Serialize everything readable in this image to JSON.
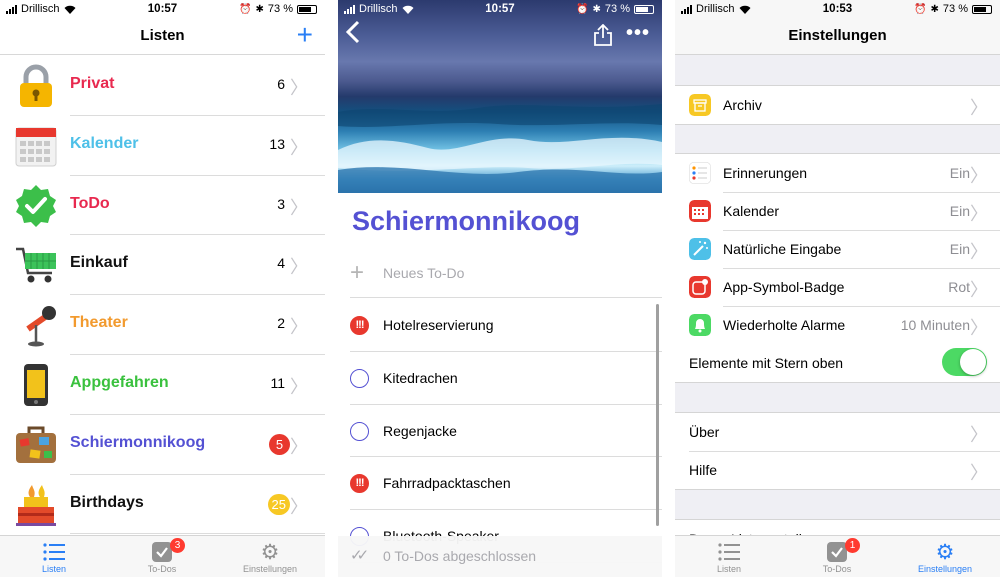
{
  "panel1": {
    "status": {
      "carrier": "Drillisch",
      "time": "10:57",
      "battery": "73 %"
    },
    "nav_title": "Listen",
    "add_symbol": "+",
    "lists": [
      {
        "name": "Privat",
        "count": "6",
        "color": "#e8294f",
        "icon": "lock-icon"
      },
      {
        "name": "Kalender",
        "count": "13",
        "color": "#4ec0e8",
        "icon": "calendar-icon"
      },
      {
        "name": "ToDo",
        "count": "3",
        "color": "#e8294f",
        "icon": "checkmark-badge-icon"
      },
      {
        "name": "Einkauf",
        "count": "4",
        "color": "#111111",
        "icon": "shopping-cart-icon"
      },
      {
        "name": "Theater",
        "count": "2",
        "color": "#f29a2e",
        "icon": "microphone-icon"
      },
      {
        "name": "Appgefahren",
        "count": "11",
        "color": "#3ac13e",
        "icon": "phone-icon"
      },
      {
        "name": "Schiermonnikoog",
        "count": "5",
        "color": "#5451d3",
        "icon": "suitcase-icon",
        "badge_color": "#e8382e"
      },
      {
        "name": "Birthdays",
        "count": "25",
        "color": "#111111",
        "icon": "birthday-cake-icon",
        "badge_color": "#f7c824"
      }
    ],
    "tabs": [
      {
        "label": "Listen",
        "icon": "list-icon",
        "active": true
      },
      {
        "label": "To-Dos",
        "icon": "todo-check-icon",
        "badge": "3"
      },
      {
        "label": "Einstellungen",
        "icon": "gear-icon"
      }
    ]
  },
  "panel2": {
    "status": {
      "carrier": "Drillisch",
      "time": "10:57",
      "battery": "73 %"
    },
    "title": "Schiermonnikoog",
    "new_todo_placeholder": "Neues To-Do",
    "todos": [
      {
        "name": "Hotelreservierung",
        "important": true
      },
      {
        "name": "Kitedrachen",
        "important": false
      },
      {
        "name": "Regenjacke",
        "important": false
      },
      {
        "name": "Fahrradpacktaschen",
        "important": true
      },
      {
        "name": "Bluetooth-Speaker",
        "important": false
      }
    ],
    "important_mark": "!!!",
    "completed_text": "0 To-Dos abgeschlossen"
  },
  "panel3": {
    "status": {
      "carrier": "Drillisch",
      "time": "10:53",
      "battery": "73 %"
    },
    "nav_title": "Einstellungen",
    "archive": {
      "label": "Archiv"
    },
    "settings": [
      {
        "label": "Erinnerungen",
        "value": "Ein",
        "icon": "reminders-icon"
      },
      {
        "label": "Kalender",
        "value": "Ein",
        "icon": "calendar-icon"
      },
      {
        "label": "Natürliche Eingabe",
        "value": "Ein",
        "icon": "magic-wand-icon"
      },
      {
        "label": "App-Symbol-Badge",
        "value": "Rot",
        "icon": "app-badge-icon"
      },
      {
        "label": "Wiederholte Alarme",
        "value": "10 Minuten",
        "icon": "bell-icon"
      }
    ],
    "starred_toggle": {
      "label": "Elemente mit Stern oben",
      "on": true
    },
    "info": [
      {
        "label": "Über"
      },
      {
        "label": "Hilfe"
      }
    ],
    "partial_row": "Demo-Liste erstellen",
    "tabs": [
      {
        "label": "Listen",
        "icon": "list-icon"
      },
      {
        "label": "To-Dos",
        "icon": "todo-check-icon",
        "badge": "1"
      },
      {
        "label": "Einstellungen",
        "icon": "gear-icon",
        "active": true
      }
    ]
  }
}
